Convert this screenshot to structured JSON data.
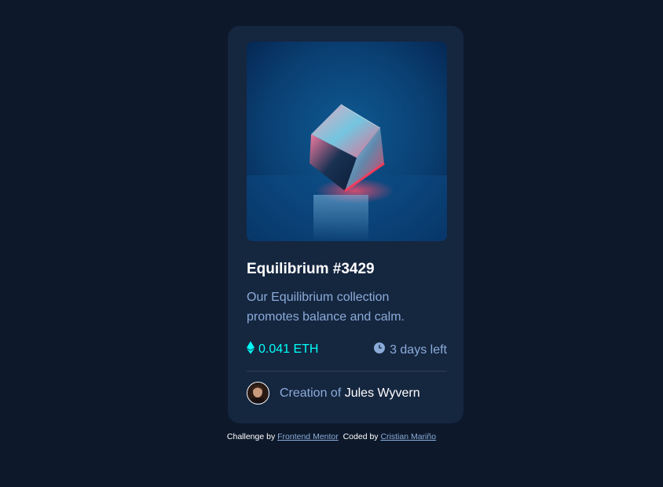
{
  "card": {
    "title": "Equilibrium #3429",
    "description": "Our Equilibrium collection promotes balance and calm.",
    "price": "0.041 ETH",
    "time_left": "3 days left",
    "creator_prefix": "Creation of",
    "creator_name": "Jules Wyvern"
  },
  "footer": {
    "challenge_prefix": "Challenge by",
    "challenge_link": "Frontend Mentor",
    "coded_prefix": "Coded by",
    "coded_link": "Cristian Mariño"
  },
  "icons": {
    "price": "ethereum-icon",
    "time": "clock-icon"
  },
  "colors": {
    "background": "#0d192b",
    "card": "#15263f",
    "accent": "#00fff8",
    "soft_blue": "#8bacd9",
    "white": "#ffffff"
  }
}
